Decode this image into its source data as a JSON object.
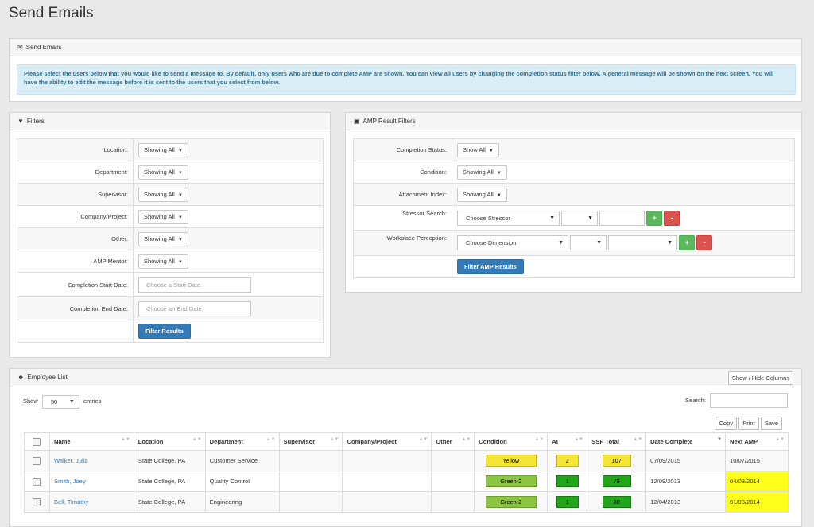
{
  "page": {
    "title": "Send Emails"
  },
  "send_panel": {
    "heading": "Send Emails",
    "info": "Please select the users below that you would like to send a message to. By default, only users who are due to complete AMP are shown. You can view all users by changing the completion status filter below. A general message will be shown on the next screen. You will have the ability to edit the message before it is sent to the users that you select from below."
  },
  "filters": {
    "heading": "Filters",
    "rows": [
      {
        "label": "Location:",
        "value": "Showing All"
      },
      {
        "label": "Department:",
        "value": "Showing All"
      },
      {
        "label": "Supervisor:",
        "value": "Showing All"
      },
      {
        "label": "Company/Project:",
        "value": "Showing All"
      },
      {
        "label": "Other:",
        "value": "Showing All"
      },
      {
        "label": "AMP Mentor:",
        "value": "Showing All"
      }
    ],
    "start_label": "Completion Start Date:",
    "start_placeholder": "Choose a Start Date.",
    "end_label": "Completion End Date:",
    "end_placeholder": "Choose an End Date.",
    "button": "Filter Results"
  },
  "amp_filters": {
    "heading": "AMP Result Filters",
    "completion_label": "Completion Status:",
    "completion_value": "Show All",
    "condition_label": "Condition:",
    "condition_value": "Showing All",
    "attachment_label": "Attachment Index:",
    "attachment_value": "Showing All",
    "stressor_label": "Stressor Search:",
    "stressor_value": "Choose Stressor",
    "perception_label": "Workplace Perception:",
    "perception_value": "Choose Dimension",
    "plus": "+",
    "minus": "-",
    "button": "Filter AMP Results"
  },
  "employee_list": {
    "heading": "Employee List",
    "toggle_columns": "Show / Hide Columns",
    "show_label": "Show",
    "entries_value": "50",
    "entries_label": "entries",
    "search_label": "Search:",
    "copy": "Copy",
    "print": "Print",
    "save": "Save",
    "columns": [
      "Name",
      "Location",
      "Department",
      "Supervisor",
      "Company/Project",
      "Other",
      "Condition",
      "AI",
      "SSP Total",
      "Date Complete",
      "Next AMP"
    ],
    "rows": [
      {
        "name": "Walker, Julia",
        "location": "State College, PA",
        "department": "Customer Service",
        "supervisor": "",
        "company": "",
        "other": "",
        "condition": "Yellow",
        "condition_color": "yellow",
        "ai": "2",
        "ai_color": "yellow",
        "ssp": "107",
        "ssp_color": "yellow",
        "date_complete": "07/09/2015",
        "next_amp": "10/07/2015",
        "next_highlight": false
      },
      {
        "name": "Smith, Joey",
        "location": "State College, PA",
        "department": "Quality Control",
        "supervisor": "",
        "company": "",
        "other": "",
        "condition": "Green-2",
        "condition_color": "green2",
        "ai": "1",
        "ai_color": "green",
        "ssp": "79",
        "ssp_color": "green",
        "date_complete": "12/09/2013",
        "next_amp": "04/08/2014",
        "next_highlight": true
      },
      {
        "name": "Bell, Timothy",
        "location": "State College, PA",
        "department": "Engineering",
        "supervisor": "",
        "company": "",
        "other": "",
        "condition": "Green-2",
        "condition_color": "green2",
        "ai": "1",
        "ai_color": "green",
        "ssp": "60",
        "ssp_color": "green",
        "date_complete": "12/04/2013",
        "next_amp": "01/03/2014",
        "next_highlight": true
      }
    ]
  }
}
